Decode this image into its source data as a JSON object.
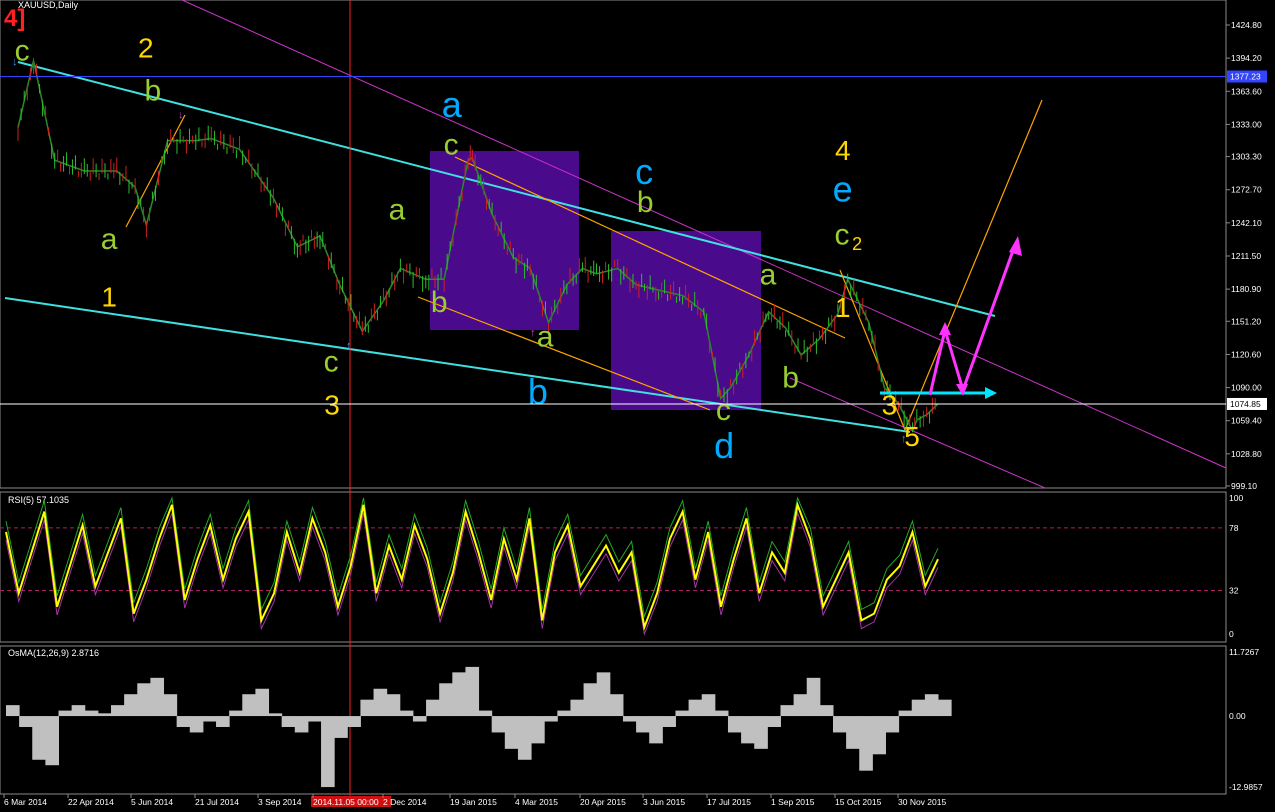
{
  "chart_data": {
    "type": "line",
    "symbol": "XAUUSD",
    "timeframe": "Daily",
    "title": "XAUUSD,Daily",
    "corner_label": "4]",
    "price_axis": {
      "ticks": [
        "1424.80",
        "1394.20",
        "1363.60",
        "1333.00",
        "1303.30",
        "1272.70",
        "1242.10",
        "1211.50",
        "1180.90",
        "1151.20",
        "1120.60",
        "1090.00",
        "1059.40",
        "1028.80",
        "999.10"
      ],
      "ylim": [
        999.1,
        1424.8
      ],
      "markers": [
        {
          "label": "1377.23",
          "price": 1377.23,
          "color": "#3344ff"
        },
        {
          "label": "1074.85",
          "price": 1074.85,
          "color": "#ffffff"
        }
      ]
    },
    "time_axis": {
      "ticks": [
        "6 Mar 2014",
        "22 Apr 2014",
        "5 Jun 2014",
        "21 Jul 2014",
        "3 Sep 2014",
        "2014.11.05 00:00",
        "2 Dec 2014",
        "19 Jan 2015",
        "4 Mar 2015",
        "20 Apr 2015",
        "3 Jun 2015",
        "17 Jul 2015",
        "1 Sep 2015",
        "15 Oct 2015",
        "30 Nov 2015"
      ],
      "cursor_date": "2014.11.05 00:00"
    },
    "price_series": {
      "name": "XAUUSD",
      "x": [
        "2014-03-06",
        "2014-03-17",
        "2014-04-01",
        "2014-04-22",
        "2014-05-15",
        "2014-05-28",
        "2014-06-05",
        "2014-06-20",
        "2014-07-10",
        "2014-07-21",
        "2014-08-10",
        "2014-09-03",
        "2014-09-20",
        "2014-10-06",
        "2014-10-20",
        "2014-11-05",
        "2014-11-20",
        "2014-12-02",
        "2014-12-20",
        "2015-01-02",
        "2015-01-19",
        "2015-01-22",
        "2015-02-05",
        "2015-02-20",
        "2015-03-04",
        "2015-03-17",
        "2015-03-30",
        "2015-04-10",
        "2015-04-20",
        "2015-05-05",
        "2015-05-18",
        "2015-06-03",
        "2015-06-20",
        "2015-07-05",
        "2015-07-17",
        "2015-07-24",
        "2015-08-06",
        "2015-08-20",
        "2015-09-01",
        "2015-09-12",
        "2015-09-25",
        "2015-10-08",
        "2015-10-15",
        "2015-10-30",
        "2015-11-10",
        "2015-11-20",
        "2015-11-30",
        "2015-12-03",
        "2015-12-10",
        "2015-12-18"
      ],
      "y": [
        1330,
        1392,
        1300,
        1290,
        1290,
        1275,
        1240,
        1318,
        1318,
        1320,
        1310,
        1265,
        1220,
        1230,
        1185,
        1142,
        1170,
        1200,
        1190,
        1190,
        1300,
        1302,
        1250,
        1210,
        1200,
        1150,
        1185,
        1200,
        1195,
        1200,
        1185,
        1180,
        1175,
        1160,
        1080,
        1090,
        1120,
        1160,
        1145,
        1120,
        1135,
        1158,
        1190,
        1150,
        1090,
        1075,
        1050,
        1060,
        1065,
        1075
      ]
    },
    "wave_labels": [
      {
        "text": "c",
        "color": "#9acd32",
        "date": "2014-03-10",
        "price": 1392
      },
      {
        "text": "2",
        "color": "#ffd700",
        "date": "2014-06-05",
        "price": 1395
      },
      {
        "text": "b",
        "color": "#9acd32",
        "date": "2014-06-10",
        "price": 1355
      },
      {
        "text": "a",
        "color": "#9acd32",
        "date": "2014-05-10",
        "price": 1218
      },
      {
        "text": "1",
        "color": "#ffd700",
        "date": "2014-05-10",
        "price": 1165
      },
      {
        "text": "a",
        "color": "#00aaff",
        "date": "2015-01-08",
        "price": 1340
      },
      {
        "text": "c",
        "color": "#9acd32",
        "date": "2015-01-08",
        "price": 1305
      },
      {
        "text": "a",
        "color": "#9acd32",
        "date": "2014-11-30",
        "price": 1245
      },
      {
        "text": "b",
        "color": "#9acd32",
        "date": "2014-12-30",
        "price": 1160
      },
      {
        "text": "c",
        "color": "#9acd32",
        "date": "2014-10-15",
        "price": 1105
      },
      {
        "text": "3",
        "color": "#ffd700",
        "date": "2014-10-15",
        "price": 1065
      },
      {
        "text": "a",
        "color": "#9acd32",
        "date": "2015-03-15",
        "price": 1128
      },
      {
        "text": "b",
        "color": "#00aaff",
        "date": "2015-03-10",
        "price": 1075
      },
      {
        "text": "c",
        "color": "#00aaff",
        "date": "2015-05-25",
        "price": 1278
      },
      {
        "text": "b",
        "color": "#9acd32",
        "date": "2015-05-25",
        "price": 1252
      },
      {
        "text": "c",
        "color": "#9acd32",
        "date": "2015-07-20",
        "price": 1060
      },
      {
        "text": "d",
        "color": "#00aaff",
        "date": "2015-07-20",
        "price": 1025
      },
      {
        "text": "a",
        "color": "#9acd32",
        "date": "2015-08-20",
        "price": 1185
      },
      {
        "text": "b",
        "color": "#9acd32",
        "date": "2015-09-05",
        "price": 1090
      },
      {
        "text": "4",
        "color": "#ffd700",
        "date": "2015-10-12",
        "price": 1300
      },
      {
        "text": "e",
        "color": "#00aaff",
        "date": "2015-10-12",
        "price": 1262
      },
      {
        "text": "c",
        "color": "#9acd32",
        "date": "2015-10-12",
        "price": 1222
      },
      {
        "text": "2",
        "color": "#ffd700",
        "date": "2015-10-22",
        "price": 1217
      },
      {
        "text": "1",
        "color": "#ffd700",
        "date": "2015-10-12",
        "price": 1155
      },
      {
        "text": "3",
        "color": "#ffd700",
        "date": "2015-11-14",
        "price": 1065
      },
      {
        "text": "5",
        "color": "#ffd700",
        "date": "2015-11-30",
        "price": 1036
      }
    ],
    "rsi": {
      "label": "RSI(5) 57.1035",
      "ylim": [
        0,
        100
      ],
      "levels": [
        78,
        32
      ],
      "ticks": [
        "100",
        "78",
        "32",
        "0"
      ],
      "values": [
        75,
        30,
        60,
        90,
        20,
        50,
        80,
        35,
        60,
        85,
        15,
        40,
        70,
        95,
        25,
        55,
        80,
        40,
        70,
        90,
        10,
        30,
        75,
        45,
        85,
        60,
        20,
        50,
        95,
        30,
        65,
        40,
        80,
        55,
        15,
        45,
        90,
        60,
        25,
        70,
        40,
        85,
        10,
        60,
        80,
        35,
        50,
        65,
        45,
        60,
        5,
        30,
        70,
        90,
        40,
        75,
        20,
        55,
        85,
        30,
        60,
        45,
        95,
        70,
        20,
        40,
        60,
        10,
        15,
        40,
        50,
        75,
        35,
        55
      ]
    },
    "osma": {
      "label": "OsMA(12,26,9) 2.8716",
      "ylim": [
        -12.9857,
        11.7267
      ],
      "ticks": [
        "11.7267",
        "0.00",
        "-12.9857"
      ],
      "values": [
        2,
        -2,
        -8,
        -9,
        1,
        2,
        1,
        0.5,
        2,
        4,
        6,
        7,
        4,
        -2,
        -3,
        -1,
        -2,
        1,
        4,
        5,
        0.5,
        -2,
        -3,
        -1,
        -13,
        -4,
        -2,
        3,
        5,
        4,
        1,
        -1,
        3,
        6,
        8,
        9,
        1,
        -3,
        -6,
        -8,
        -5,
        -1,
        1,
        3,
        6,
        8,
        4,
        -1,
        -3,
        -5,
        -2,
        1,
        3,
        4,
        1,
        -3,
        -5,
        -6,
        -2,
        2,
        4,
        7,
        2,
        -3,
        -6,
        -10,
        -7,
        -3,
        1,
        3,
        4,
        3
      ]
    }
  }
}
